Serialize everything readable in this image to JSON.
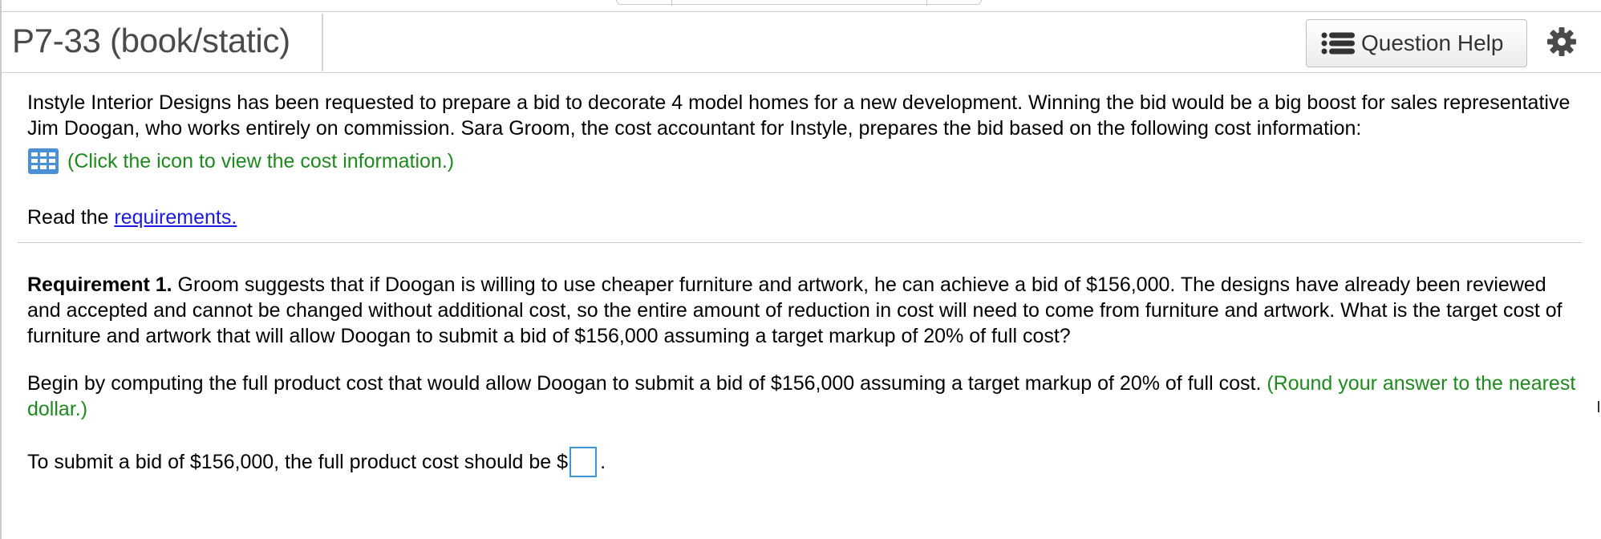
{
  "header": {
    "title": "P7-33 (book/static)",
    "question_help_label": "Question Help",
    "settings_icon": "gear-icon"
  },
  "problem": {
    "intro": "Instyle Interior Designs has been requested to prepare a bid to decorate 4 model homes for a new development. Winning the bid would be a big boost for sales representative Jim Doogan, who works entirely on commission. Sara Groom, the cost accountant for Instyle, prepares the bid based on the following cost information:",
    "cost_info_link": "(Click the icon to view the cost information.)",
    "read_prefix": "Read the",
    "requirements_link": "requirements."
  },
  "requirement1": {
    "label": "Requirement 1.",
    "text": " Groom suggests that if Doogan is willing to use cheaper furniture and artwork, he can achieve a bid of $156,000. The designs have already been reviewed and accepted and cannot be changed without additional cost, so the entire amount of reduction in cost will need to come from furniture and artwork. What is the target cost of furniture and artwork that will allow Doogan to submit a bid of $156,000 assuming a target markup of 20% of full cost?",
    "begin_text": "Begin by computing the full product cost that would allow Doogan to submit a bid of $156,000 assuming a target markup of 20% of full cost. ",
    "round_note": "(Round your answer to the nearest dollar.)",
    "final_prefix": "To submit a bid of $156,000, the full product cost should be $",
    "final_suffix": ".",
    "answer_value": ""
  },
  "colors": {
    "accent_green": "#1e8a1e",
    "link_blue": "#1a1ae0",
    "input_border": "#3a9ad9"
  }
}
